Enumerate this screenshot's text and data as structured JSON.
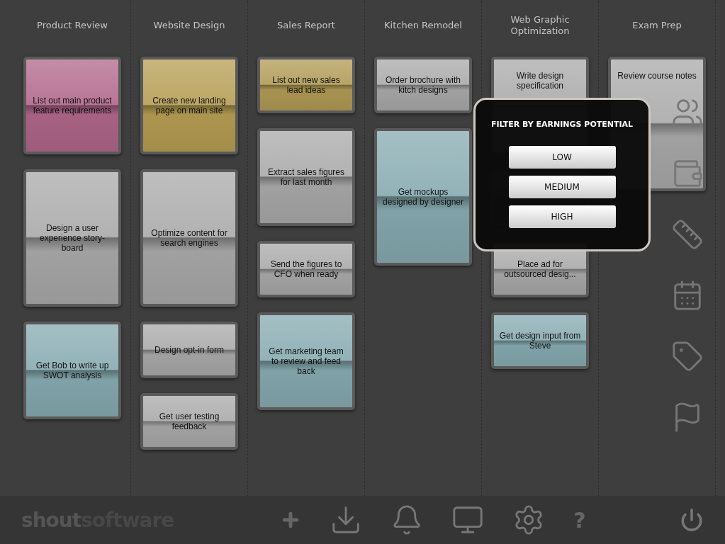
{
  "columns": [
    {
      "title": "Product Review",
      "cards": [
        {
          "text": "List out main product feature requirements",
          "kind": "medium",
          "color": "#b0668a"
        },
        {
          "text": "Design a user experience story-board",
          "kind": "large",
          "color": "#a9a9a9"
        },
        {
          "text": "Get Bob to write up SWOT analysis",
          "kind": "medium",
          "color": "#86aab0"
        }
      ]
    },
    {
      "title": "Website Design",
      "cards": [
        {
          "text": "Create new landing page on main site",
          "kind": "medium",
          "color": "#b59d52"
        },
        {
          "text": "Optimize content for search engines",
          "kind": "large",
          "color": "#a9a9a9"
        },
        {
          "text": "Design opt-in form",
          "kind": "small",
          "color": "#a9a9a9"
        },
        {
          "text": "Get user testing feedback",
          "kind": "small",
          "color": "#a9a9a9"
        }
      ]
    },
    {
      "title": "Sales Report",
      "cards": [
        {
          "text": "List out new sales lead ideas",
          "kind": "small",
          "color": "#b09a55"
        },
        {
          "text": "Extract sales figures for last month",
          "kind": "medium",
          "color": "#a9a9a9"
        },
        {
          "text": "Send the figures to CFO when ready",
          "kind": "small",
          "color": "#a9a9a9"
        },
        {
          "text": "Get marketing team to review and feed back",
          "kind": "medium",
          "color": "#86aab0"
        }
      ]
    },
    {
      "title": "Kitchen Remodel",
      "cards": [
        {
          "text": "Order brochure with kitch designs",
          "kind": "small",
          "color": "#a9a9a9"
        },
        {
          "text": "Get mockups designed by designer",
          "kind": "large",
          "color": "#86aab0"
        }
      ]
    },
    {
      "title": "Web Graphic Optimization",
      "cards": [
        {
          "text": "Write design specification",
          "kind": "medium",
          "color": "#a9a9a9"
        },
        {
          "kind": "small"
        },
        {
          "text": "Place ad for outsourced desig...",
          "kind": "small",
          "color": "#a9a9a9"
        },
        {
          "text": "Get design input from Steve",
          "kind": "small",
          "color": "#86aab0"
        }
      ]
    },
    {
      "title": "Exam Prep",
      "cards": [
        {
          "text": "Review course notes",
          "kind": "tall",
          "color": "#a9a9a9"
        }
      ]
    }
  ],
  "filter_popup": {
    "title": "FILTER BY EARNINGS POTENTIAL",
    "buttons": [
      "LOW",
      "MEDIUM",
      "HIGH"
    ]
  },
  "sidebar": [
    {
      "kind": "people"
    },
    {
      "kind": "wallet"
    },
    {
      "kind": "ruler"
    },
    {
      "kind": "calendar"
    },
    {
      "kind": "tag"
    },
    {
      "kind": "flag"
    }
  ],
  "bottom_bar": {
    "logo": {
      "first": "shout",
      "second": "software"
    },
    "help": "?"
  }
}
